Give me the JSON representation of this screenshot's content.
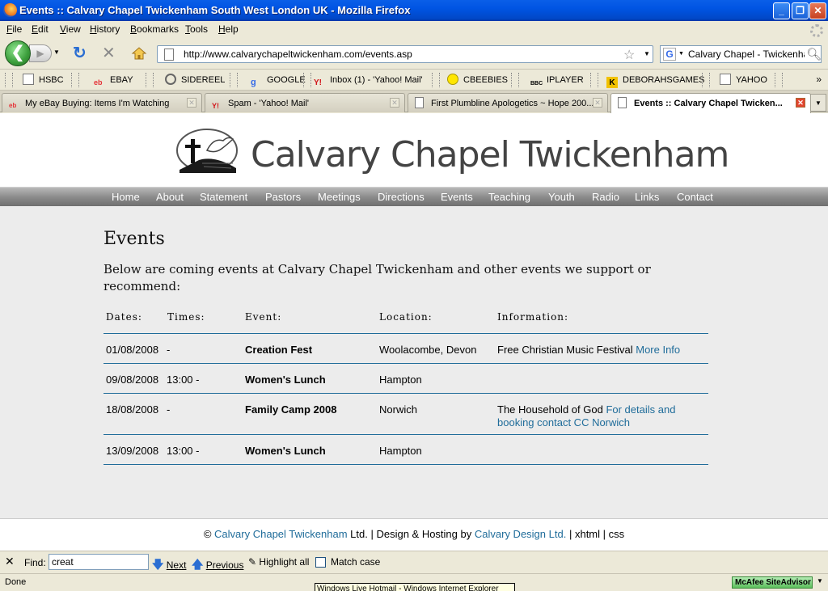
{
  "window": {
    "title": "Events :: Calvary Chapel Twickenham South West London UK - Mozilla Firefox"
  },
  "menu": [
    "File",
    "Edit",
    "View",
    "History",
    "Bookmarks",
    "Tools",
    "Help"
  ],
  "address": {
    "url": "http://www.calvarychapeltwickenham.com/events.asp"
  },
  "search": {
    "engine_value": "Calvary Chapel - Twickenham"
  },
  "bookmarks": [
    "HSBC",
    "EBAY",
    "SIDEREEL",
    "GOOGLE",
    "Inbox (1) - 'Yahoo! Mail'",
    "CBEEBIES",
    "IPLAYER",
    "DEBORAHSGAMES",
    "YAHOO"
  ],
  "tabs": [
    {
      "label": "My eBay Buying: Items I'm Watching"
    },
    {
      "label": "Spam - 'Yahoo! Mail'"
    },
    {
      "label": "First Plumbline Apologetics ~ Hope 200..."
    },
    {
      "label": "Events :: Calvary Chapel Twicken..."
    }
  ],
  "site": {
    "title": "Calvary Chapel Twickenham",
    "nav": [
      "Home",
      "About",
      "Statement",
      "Pastors",
      "Meetings",
      "Directions",
      "Events",
      "Teaching",
      "Youth",
      "Radio",
      "Links",
      "Contact"
    ]
  },
  "page": {
    "heading": "Events",
    "intro": "Below are coming events at Calvary Chapel Twickenham and other events we support or recommend:",
    "columns": [
      "Dates:",
      "Times:",
      "Event:",
      "Location:",
      "Information:"
    ],
    "rows": [
      {
        "date": "01/08/2008",
        "time": "-",
        "event": "Creation Fest",
        "location": "Woolacombe, Devon",
        "info": "Free Christian Music Festival",
        "link": "More Info"
      },
      {
        "date": "09/08/2008",
        "time": "13:00 -",
        "event": "Women's Lunch",
        "location": "Hampton",
        "info": "",
        "link": ""
      },
      {
        "date": "18/08/2008",
        "time": "-",
        "event": "Family Camp 2008",
        "location": "Norwich",
        "info": "The Household of God",
        "link": "For details and booking contact CC Norwich"
      },
      {
        "date": "13/09/2008",
        "time": "13:00 -",
        "event": "Women's Lunch",
        "location": "Hampton",
        "info": "",
        "link": ""
      }
    ]
  },
  "footer": {
    "copyright": "©",
    "link1": "Calvary Chapel Twickenham",
    "text1": "Ltd. | Design & Hosting by",
    "link2": "Calvary Design Ltd.",
    "sep": "|",
    "xhtml": "xhtml",
    "css": "css"
  },
  "findbar": {
    "label": "Find:",
    "value": "creat",
    "next": "Next",
    "previous": "Previous",
    "highlight": "Highlight all",
    "match": "Match case"
  },
  "status": {
    "text": "Done",
    "tooltip": "Windows Live Hotmail - Windows Internet Explorer",
    "addon": "McAfee SiteAdvisor"
  },
  "colors": {
    "titlebar": "#0054e3",
    "link": "#1f6c9a",
    "nav_bg": "#8c8c8c",
    "page_bg": "#ececec"
  }
}
